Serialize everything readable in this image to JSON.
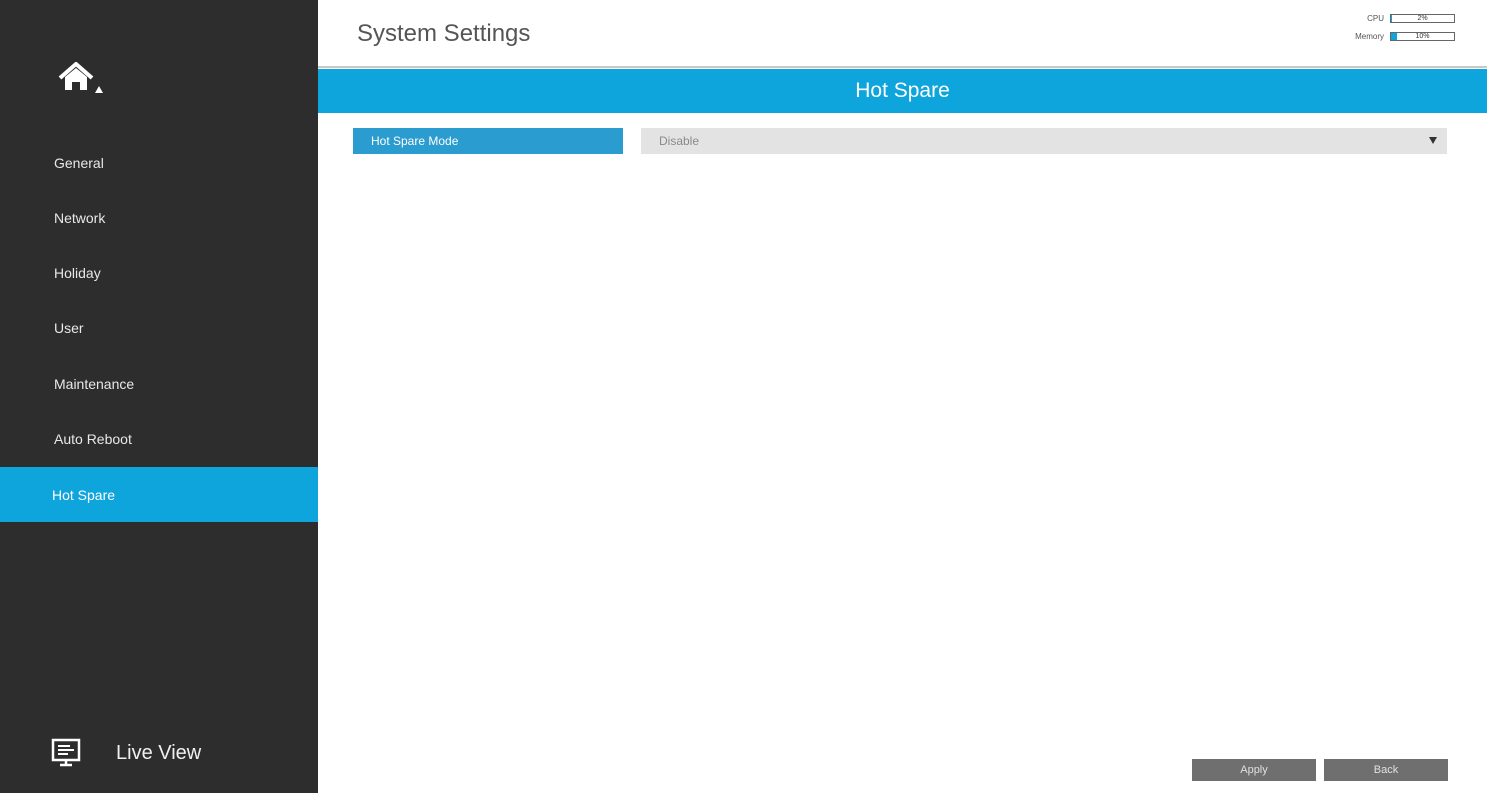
{
  "sidebar": {
    "items": [
      {
        "label": "General"
      },
      {
        "label": "Network"
      },
      {
        "label": "Holiday"
      },
      {
        "label": "User"
      },
      {
        "label": "Maintenance"
      },
      {
        "label": "Auto Reboot"
      },
      {
        "label": "Hot Spare"
      }
    ],
    "active_item": "Hot Spare",
    "live_view_label": "Live View"
  },
  "header": {
    "title": "System Settings",
    "stats": {
      "cpu": {
        "label": "CPU",
        "value": "2%",
        "fraction": 0.02
      },
      "memory": {
        "label": "Memory",
        "value": "10%",
        "fraction": 0.1
      }
    }
  },
  "section": {
    "title": "Hot Spare"
  },
  "form": {
    "hot_spare_mode": {
      "label": "Hot Spare Mode",
      "value": "Disable"
    }
  },
  "buttons": {
    "apply": "Apply",
    "back": "Back"
  },
  "colors": {
    "accent": "#0ea5dd",
    "sidebar_bg": "#2d2d2d",
    "button_bg": "#6f6f6f"
  }
}
